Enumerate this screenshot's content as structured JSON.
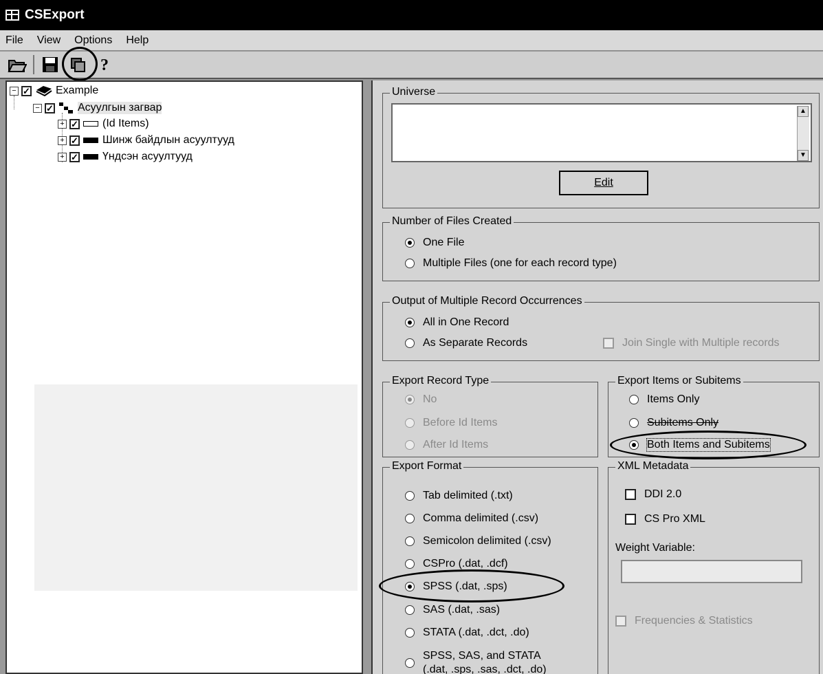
{
  "window": {
    "title": "CSExport"
  },
  "menu": [
    "File",
    "View",
    "Options",
    "Help"
  ],
  "toolbar": {
    "buttons": [
      {
        "name": "open-icon"
      },
      {
        "name": "save-icon"
      },
      {
        "name": "run-icon"
      },
      {
        "name": "help-icon"
      }
    ]
  },
  "tree": {
    "root": {
      "label": "Example",
      "checked": true
    },
    "level": {
      "label": "Асуулгын загвар",
      "checked": true
    },
    "records": [
      {
        "label": "(Id Items)",
        "checked": true
      },
      {
        "label": "Шинж байдлын асуултууд",
        "checked": true
      },
      {
        "label": "Үндсэн асуултууд",
        "checked": true
      }
    ]
  },
  "universe": {
    "legend": "Universe",
    "value": "",
    "edit_label": "Edit"
  },
  "files": {
    "legend": "Number of Files Created",
    "options": [
      "One File",
      "Multiple Files (one for each record type)"
    ],
    "selected": 0
  },
  "occurrences": {
    "legend": "Output of Multiple Record Occurrences",
    "options": [
      "All in One Record",
      "As Separate Records"
    ],
    "selected": 0,
    "join_label": "Join Single with Multiple records"
  },
  "record_type": {
    "legend": "Export Record Type",
    "options": [
      "No",
      "Before Id Items",
      "After Id Items"
    ],
    "selected": 0
  },
  "items": {
    "legend": "Export Items or Subitems",
    "options": [
      "Items Only",
      "Subitems Only",
      "Both Items and Subitems"
    ],
    "selected": 2
  },
  "format": {
    "legend": "Export Format",
    "options": [
      "Tab delimited (.txt)",
      "Comma delimited (.csv)",
      "Semicolon delimited (.csv)",
      "CSPro (.dat, .dcf)",
      "SPSS (.dat, .sps)",
      "SAS (.dat, .sas)",
      "STATA (.dat, .dct, .do)",
      "SPSS, SAS, and STATA",
      "(.dat, .sps, .sas, .dct, .do)"
    ],
    "selected": 4
  },
  "xml": {
    "legend": "XML Metadata",
    "options": [
      "DDI 2.0",
      "CS Pro XML"
    ],
    "weight_label": "Weight Variable:",
    "weight_value": "",
    "freq_label": "Frequencies & Statistics"
  }
}
